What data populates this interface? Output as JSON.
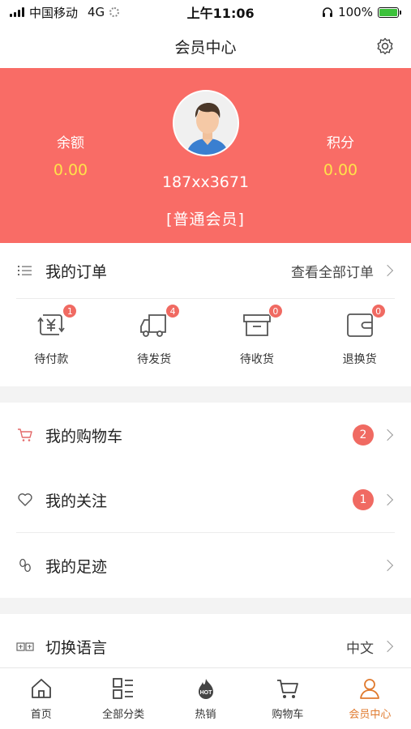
{
  "status_bar": {
    "carrier": "中国移动",
    "network": "4G",
    "time": "上午11:06",
    "battery": "100%"
  },
  "header": {
    "title": "会员中心"
  },
  "profile": {
    "balance_label": "余额",
    "balance_value": "0.00",
    "points_label": "积分",
    "points_value": "0.00",
    "phone": "187xx3671",
    "level": "[普通会员]"
  },
  "orders": {
    "title": "我的订单",
    "view_all": "查看全部订单",
    "items": [
      {
        "label": "待付款",
        "count": "1",
        "icon": "yuan-exchange-icon"
      },
      {
        "label": "待发货",
        "count": "4",
        "icon": "truck-icon"
      },
      {
        "label": "待收货",
        "count": "0",
        "icon": "box-icon"
      },
      {
        "label": "退换货",
        "count": "0",
        "icon": "wallet-return-icon"
      }
    ]
  },
  "menu": {
    "cart": {
      "label": "我的购物车",
      "count": "2",
      "icon": "cart-icon"
    },
    "favorites": {
      "label": "我的关注",
      "count": "1",
      "icon": "heart-icon"
    },
    "footprints": {
      "label": "我的足迹",
      "icon": "footprint-icon"
    },
    "language": {
      "label": "切换语言",
      "value": "中文",
      "icon": "language-icon"
    }
  },
  "tabbar": {
    "items": [
      {
        "label": "首页",
        "icon": "home-icon"
      },
      {
        "label": "全部分类",
        "icon": "category-icon"
      },
      {
        "label": "热销",
        "icon": "hot-icon"
      },
      {
        "label": "购物车",
        "icon": "cart-icon"
      },
      {
        "label": "会员中心",
        "icon": "user-icon",
        "active": true
      }
    ]
  },
  "colors": {
    "hero": "#f96c66",
    "accent_yellow": "#ffe24a",
    "badge": "#f06a62",
    "active_tab": "#e07a2e"
  }
}
